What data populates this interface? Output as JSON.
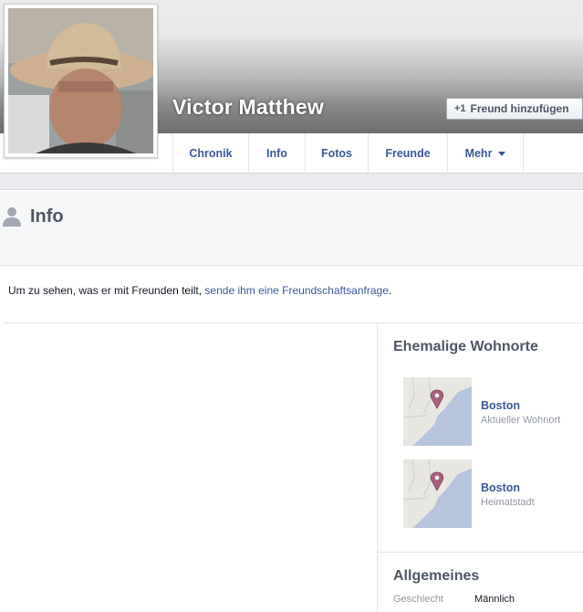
{
  "profile": {
    "name": "Victor Matthew",
    "add_friend_label": "Freund hinzufügen",
    "add_friend_icon": "plus-one-icon"
  },
  "nav": {
    "tabs": [
      {
        "label": "Chronik"
      },
      {
        "label": "Info"
      },
      {
        "label": "Fotos"
      },
      {
        "label": "Freunde"
      },
      {
        "label": "Mehr"
      }
    ]
  },
  "info_section": {
    "title": "Info",
    "icon": "person-icon"
  },
  "notice": {
    "text": "Um zu sehen, was er mit Freunden teilt, ",
    "link": "sende ihm eine Freundschaftsanfrage",
    "suffix": "."
  },
  "places": {
    "title": "Ehemalige Wohnorte",
    "items": [
      {
        "name": "Boston",
        "subtitle": "Aktueller Wohnort",
        "icon": "map-pin-icon"
      },
      {
        "name": "Boston",
        "subtitle": "Heimatstadt",
        "icon": "map-pin-icon"
      }
    ]
  },
  "general": {
    "title": "Allgemeines",
    "rows": [
      {
        "label": "Geschlecht",
        "value": "Männlich"
      }
    ]
  },
  "colors": {
    "link": "#3b5998",
    "header_gray": "#4e5665",
    "map_water": "#b6c4de",
    "map_land": "#e8e7e2",
    "pin": "#a8617c"
  }
}
